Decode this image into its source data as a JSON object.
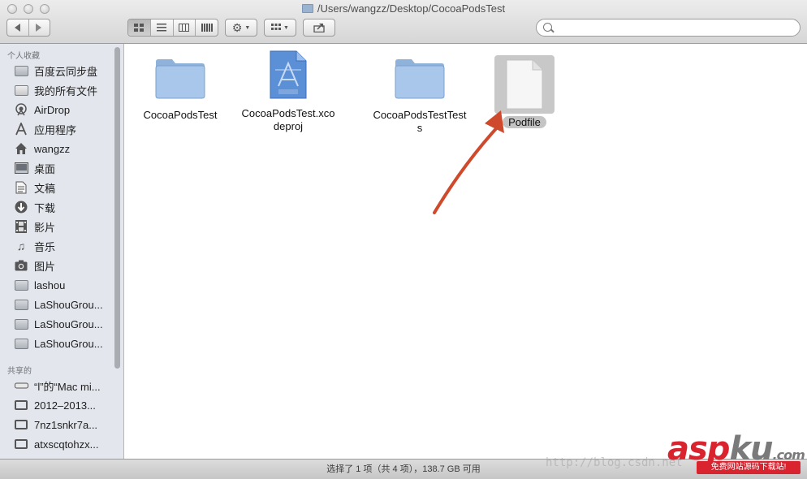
{
  "window": {
    "path_title": "/Users/wangzz/Desktop/CocoaPodsTest"
  },
  "toolbar": {
    "back_icon": "back-arrow-icon",
    "forward_icon": "forward-arrow-icon",
    "view_modes": [
      "icon-view",
      "list-view",
      "column-view",
      "coverflow-view"
    ],
    "active_view": "icon-view",
    "action_icon": "gear-icon",
    "arrange_icon": "arrange-icon",
    "share_icon": "share-icon",
    "search_placeholder": ""
  },
  "sidebar": {
    "favorites_header": "个人收藏",
    "favorites": [
      {
        "label": "百度云同步盘",
        "icon": "folder-icon"
      },
      {
        "label": "我的所有文件",
        "icon": "all-files-icon"
      },
      {
        "label": "AirDrop",
        "icon": "airdrop-icon"
      },
      {
        "label": "应用程序",
        "icon": "applications-icon"
      },
      {
        "label": "wangzz",
        "icon": "home-icon"
      },
      {
        "label": "桌面",
        "icon": "desktop-icon"
      },
      {
        "label": "文稿",
        "icon": "documents-icon"
      },
      {
        "label": "下载",
        "icon": "downloads-icon"
      },
      {
        "label": "影片",
        "icon": "movies-icon"
      },
      {
        "label": "音乐",
        "icon": "music-icon"
      },
      {
        "label": "图片",
        "icon": "pictures-icon"
      },
      {
        "label": "lashou",
        "icon": "folder-icon"
      },
      {
        "label": "LaShouGrou...",
        "icon": "folder-icon"
      },
      {
        "label": "LaShouGrou...",
        "icon": "folder-icon"
      },
      {
        "label": "LaShouGrou...",
        "icon": "folder-icon"
      }
    ],
    "shared_header": "共享的",
    "shared": [
      {
        "label": "“l”的“Mac mi...",
        "icon": "mac-mini-icon"
      },
      {
        "label": "2012–2013...",
        "icon": "monitor-icon"
      },
      {
        "label": "7nz1snkr7a...",
        "icon": "monitor-icon"
      },
      {
        "label": "atxscqtohzx...",
        "icon": "monitor-icon"
      }
    ]
  },
  "files": [
    {
      "name": "CocoaPodsTest",
      "type": "folder"
    },
    {
      "name": "CocoaPodsTest.xcodeproj",
      "name_lines": [
        "CocoaPodsTest.xco",
        "deproj"
      ],
      "type": "xcodeproj"
    },
    {
      "name": "CocoaPodsTestTests",
      "name_lines": [
        "CocoaPodsTestTest",
        "s"
      ],
      "type": "folder"
    },
    {
      "name": "Podfile",
      "type": "document",
      "selected": true
    }
  ],
  "status": {
    "text": "选择了 1 项（共 4 项），138.7 GB 可用"
  },
  "overlay": {
    "watermark_url": "http://blog.csdn.net",
    "logo_asp": "asp",
    "logo_ku": "ku",
    "logo_com": ".com",
    "logo_tagline": "免费网站源码下载站!"
  },
  "colors": {
    "arrow": "#cf4a2c",
    "selection": "#c4c4c4",
    "sidebar_bg": "#e3e7ed"
  }
}
